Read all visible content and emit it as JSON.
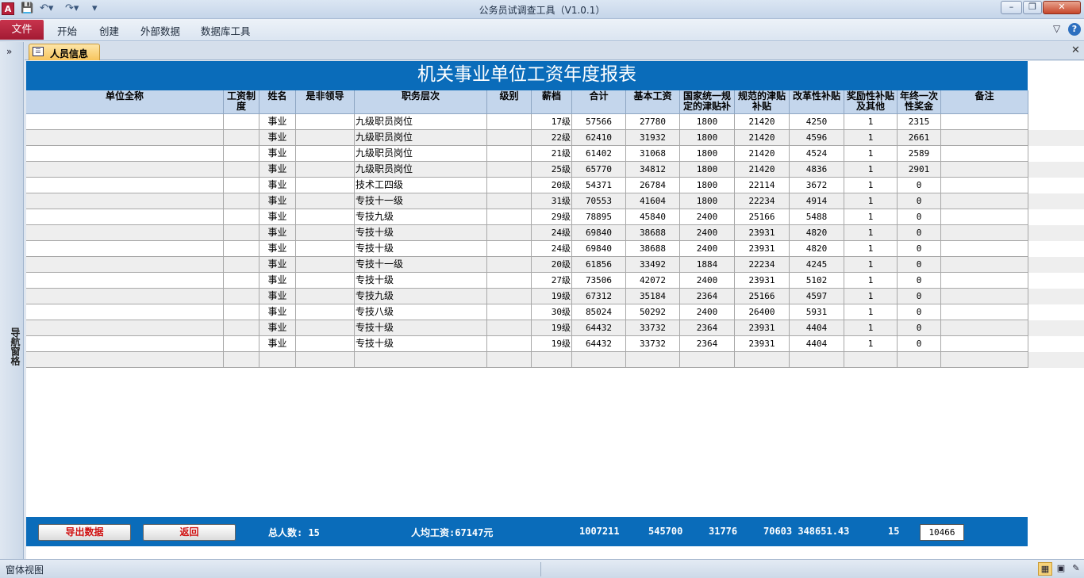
{
  "window": {
    "app_logo": "A",
    "title": "公务员试调查工具（V1.0.1）",
    "qat_icons": [
      "save-icon",
      "undo-icon",
      "redo-icon",
      "customize-icon"
    ]
  },
  "ribbon": {
    "file_tab": "文件",
    "tabs": [
      "开始",
      "创建",
      "外部数据",
      "数据库工具"
    ]
  },
  "nav_pane": {
    "label": "导航窗格",
    "expand": "»"
  },
  "doc_tab": {
    "label": "人员信息"
  },
  "report": {
    "title": "机关事业单位工资年度报表",
    "columns": [
      "单位全称",
      "工资制度",
      "姓名",
      "是非领导",
      "职务层次",
      "级别",
      "薪档",
      "合计",
      "基本工资",
      "国家统一规定的津贴补",
      "规范的津贴补贴",
      "改革性补贴",
      "奖励性补贴及其他",
      "年终一次性奖金",
      "备注"
    ],
    "rows": [
      {
        "c0": "",
        "c1": "",
        "c2": "事业",
        "c3": "",
        "c4": "九级职员岗位",
        "c5": "",
        "c6": "17级",
        "c7": "57566",
        "c8": "27780",
        "c9": "1800",
        "c10": "21420",
        "c11": "4250",
        "c12": "1",
        "c13": "2315",
        "c14": ""
      },
      {
        "c0": "",
        "c1": "",
        "c2": "事业",
        "c3": "",
        "c4": "九级职员岗位",
        "c5": "",
        "c6": "22级",
        "c7": "62410",
        "c8": "31932",
        "c9": "1800",
        "c10": "21420",
        "c11": "4596",
        "c12": "1",
        "c13": "2661",
        "c14": ""
      },
      {
        "c0": "",
        "c1": "",
        "c2": "事业",
        "c3": "",
        "c4": "九级职员岗位",
        "c5": "",
        "c6": "21级",
        "c7": "61402",
        "c8": "31068",
        "c9": "1800",
        "c10": "21420",
        "c11": "4524",
        "c12": "1",
        "c13": "2589",
        "c14": ""
      },
      {
        "c0": "",
        "c1": "",
        "c2": "事业",
        "c3": "",
        "c4": "九级职员岗位",
        "c5": "",
        "c6": "25级",
        "c7": "65770",
        "c8": "34812",
        "c9": "1800",
        "c10": "21420",
        "c11": "4836",
        "c12": "1",
        "c13": "2901",
        "c14": ""
      },
      {
        "c0": "",
        "c1": "",
        "c2": "事业",
        "c3": "",
        "c4": "技术工四级",
        "c5": "",
        "c6": "20级",
        "c7": "54371",
        "c8": "26784",
        "c9": "1800",
        "c10": "22114",
        "c11": "3672",
        "c12": "1",
        "c13": "0",
        "c14": ""
      },
      {
        "c0": "",
        "c1": "",
        "c2": "事业",
        "c3": "",
        "c4": "专技十一级",
        "c5": "",
        "c6": "31级",
        "c7": "70553",
        "c8": "41604",
        "c9": "1800",
        "c10": "22234",
        "c11": "4914",
        "c12": "1",
        "c13": "0",
        "c14": ""
      },
      {
        "c0": "",
        "c1": "",
        "c2": "事业",
        "c3": "",
        "c4": "专技九级",
        "c5": "",
        "c6": "29级",
        "c7": "78895",
        "c8": "45840",
        "c9": "2400",
        "c10": "25166",
        "c11": "5488",
        "c12": "1",
        "c13": "0",
        "c14": ""
      },
      {
        "c0": "",
        "c1": "",
        "c2": "事业",
        "c3": "",
        "c4": "专技十级",
        "c5": "",
        "c6": "24级",
        "c7": "69840",
        "c8": "38688",
        "c9": "2400",
        "c10": "23931",
        "c11": "4820",
        "c12": "1",
        "c13": "0",
        "c14": ""
      },
      {
        "c0": "",
        "c1": "",
        "c2": "事业",
        "c3": "",
        "c4": "专技十级",
        "c5": "",
        "c6": "24级",
        "c7": "69840",
        "c8": "38688",
        "c9": "2400",
        "c10": "23931",
        "c11": "4820",
        "c12": "1",
        "c13": "0",
        "c14": ""
      },
      {
        "c0": "",
        "c1": "",
        "c2": "事业",
        "c3": "",
        "c4": "专技十一级",
        "c5": "",
        "c6": "20级",
        "c7": "61856",
        "c8": "33492",
        "c9": "1884",
        "c10": "22234",
        "c11": "4245",
        "c12": "1",
        "c13": "0",
        "c14": ""
      },
      {
        "c0": "",
        "c1": "",
        "c2": "事业",
        "c3": "",
        "c4": "专技十级",
        "c5": "",
        "c6": "27级",
        "c7": "73506",
        "c8": "42072",
        "c9": "2400",
        "c10": "23931",
        "c11": "5102",
        "c12": "1",
        "c13": "0",
        "c14": ""
      },
      {
        "c0": "",
        "c1": "",
        "c2": "事业",
        "c3": "",
        "c4": "专技九级",
        "c5": "",
        "c6": "19级",
        "c7": "67312",
        "c8": "35184",
        "c9": "2364",
        "c10": "25166",
        "c11": "4597",
        "c12": "1",
        "c13": "0",
        "c14": ""
      },
      {
        "c0": "",
        "c1": "",
        "c2": "事业",
        "c3": "",
        "c4": "专技八级",
        "c5": "",
        "c6": "30级",
        "c7": "85024",
        "c8": "50292",
        "c9": "2400",
        "c10": "26400",
        "c11": "5931",
        "c12": "1",
        "c13": "0",
        "c14": ""
      },
      {
        "c0": "",
        "c1": "",
        "c2": "事业",
        "c3": "",
        "c4": "专技十级",
        "c5": "",
        "c6": "19级",
        "c7": "64432",
        "c8": "33732",
        "c9": "2364",
        "c10": "23931",
        "c11": "4404",
        "c12": "1",
        "c13": "0",
        "c14": ""
      },
      {
        "c0": "",
        "c1": "",
        "c2": "事业",
        "c3": "",
        "c4": "专技十级",
        "c5": "",
        "c6": "19级",
        "c7": "64432",
        "c8": "33732",
        "c9": "2364",
        "c10": "23931",
        "c11": "4404",
        "c12": "1",
        "c13": "0",
        "c14": ""
      },
      {
        "c0": "",
        "c1": "",
        "c2": "",
        "c3": "",
        "c4": "",
        "c5": "",
        "c6": "",
        "c7": "",
        "c8": "",
        "c9": "",
        "c10": "",
        "c11": "",
        "c12": "",
        "c13": "",
        "c14": ""
      }
    ]
  },
  "footer": {
    "export_button": "导出数据",
    "back_button": "返回",
    "total_count": "总人数: 15",
    "avg_salary": "人均工资:67147元",
    "sum_total": "1007211",
    "sum_basic": "545700",
    "sum_national": "31776",
    "sum_reform_combo": "70603 348651.43",
    "sum_bonus": "15",
    "sum_yearend": "10466"
  },
  "status_bar": {
    "text": "窗体视图"
  }
}
